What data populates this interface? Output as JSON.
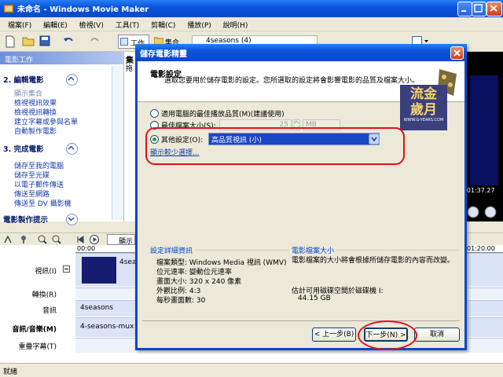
{
  "window": {
    "title": "未命名 - Windows Movie Maker"
  },
  "menu": [
    "檔案(F)",
    "編輯(E)",
    "檢視(V)",
    "工具(T)",
    "剪輯(C)",
    "播放(P)",
    "說明(H)"
  ],
  "toolbar": {
    "tasks_label": "工作",
    "collections_label": "集合",
    "collection_combo": "4seasons (4)"
  },
  "taskpane": {
    "header": "電影工作",
    "section2": "2. 編輯電影",
    "section2_items": [
      "顯示集合",
      "檢視視訊效果",
      "檢視視訊轉換",
      "建立字幕或參與名單",
      "自動製作電影"
    ],
    "section3": "3. 完成電影",
    "section3_items": [
      "儲存至我的電腦",
      "儲存至光碟",
      "以電子郵件傳送",
      "傳送至網路",
      "傳送至 DV 攝影機"
    ],
    "tips": "電影製作提示"
  },
  "collection": {
    "title_part": "集",
    "sub_part": "拖"
  },
  "preview": {
    "time": "0:01:37.27"
  },
  "storyboard": {
    "show_label": "顯示"
  },
  "timeline": {
    "ruler_start": "00:00",
    "ruler_end": "01:20.00",
    "tracks": [
      "視訊(I)",
      "轉換(R)",
      "音訊",
      "音訊/音樂(M)",
      "重疊字幕(T)"
    ],
    "video_clip": "4sea",
    "audio_clip": "4seasons",
    "music_clip": "4-seasons-mux"
  },
  "status": "就緒",
  "dialog": {
    "title": "儲存電影精靈",
    "heading": "電影設定",
    "description": "選取您要用於儲存電影的設定。您所選取的設定將會影響電影的品質及檔案大小。",
    "option_best": "適用電腦的最佳播放品質(M)(建議使用)",
    "option_best_size": "最佳檔案大小(S):",
    "size_value": "25",
    "size_unit": "MB",
    "option_other": "其他設定(O):",
    "other_value": "高品質視訊 (小)",
    "fewer_choices": "顯示較少選擇...",
    "details_title": "設定詳細資訊",
    "details": [
      "檔案類型: Windows Media 視訊 (WMV)",
      "位元速率: 變動位元速率",
      "畫面大小: 320 x 240 像素",
      "外觀比例: 4:3",
      "每秒畫面數: 30"
    ],
    "filesize_title": "電影檔案大小",
    "filesize_desc": "電影檔案的大小將會根據所儲存電影的內容而改變。",
    "space_label": "估計可用磁碟空間於磁碟機 I:",
    "space_value": "44.15 GB",
    "back_button": "< 上一步(B)",
    "next_button": "下一步(N) >",
    "cancel_button": "取消"
  },
  "watermark": {
    "line1": "流金",
    "line2": "歲月",
    "site": "WWW.G-YEARS.COM"
  },
  "colors": {
    "accent_blue": "#0a55de",
    "highlight_red": "#e0101a",
    "link_blue": "#153aa8"
  }
}
